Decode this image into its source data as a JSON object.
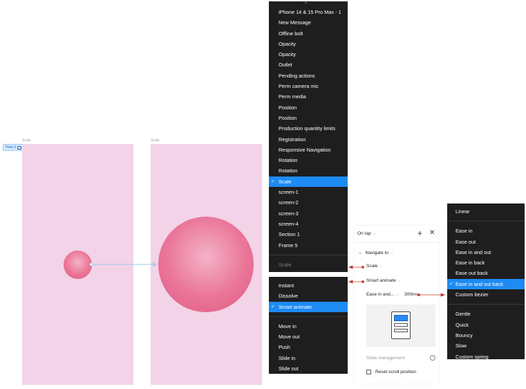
{
  "canvas": {
    "flow_label": "Flow 3",
    "frame1_label": "Scale",
    "frame2_label": "Scale",
    "frame_color": "#f2d3e7",
    "circle_color": "#ea7598"
  },
  "frame_menu": {
    "items": [
      "iPhone 14 & 15 Pro Max - 1",
      "New Message",
      "Offline bolt",
      "Opacity",
      "Opacity",
      "Outlet",
      "Pending actions",
      "Perm camera mic",
      "Perm media",
      "Position",
      "Position",
      "Production quantity limits",
      "Registration",
      "Responsive Navigation",
      "Rotation",
      "Rotation",
      "Scale",
      "screen-1",
      "screen-2",
      "screen-3",
      "screen-4",
      "Section 1",
      "Frame 5"
    ],
    "selected_index": 16,
    "footer": "Scale"
  },
  "animation_menu": {
    "items_group1": [
      "Instant",
      "Dissolve",
      "Smart animate"
    ],
    "selected": "Smart animate",
    "items_group2": [
      "Move in",
      "Move out",
      "Push",
      "Slide in",
      "Slide out"
    ]
  },
  "panel": {
    "trigger": "On tap",
    "action": "Navigate to",
    "destination": "Scale",
    "animation": "Smart animate",
    "easing": "Ease in and...",
    "duration": "300ms",
    "state_management": "State management",
    "reset_scroll": "Reset scroll position"
  },
  "easing_menu": {
    "items_group1": [
      "Linear"
    ],
    "items_group2": [
      "Ease in",
      "Ease out",
      "Ease in and out",
      "Ease in back",
      "Ease out back",
      "Ease in and out back",
      "Custom bezier"
    ],
    "selected": "Ease in and out back",
    "items_group3": [
      "Gentle",
      "Quick",
      "Bouncy",
      "Slow",
      "Custom spring"
    ]
  },
  "colors": {
    "accent": "#1d8bf2",
    "menu_bg": "#1e1e1e",
    "annotation_arrow": "#c0392b"
  }
}
